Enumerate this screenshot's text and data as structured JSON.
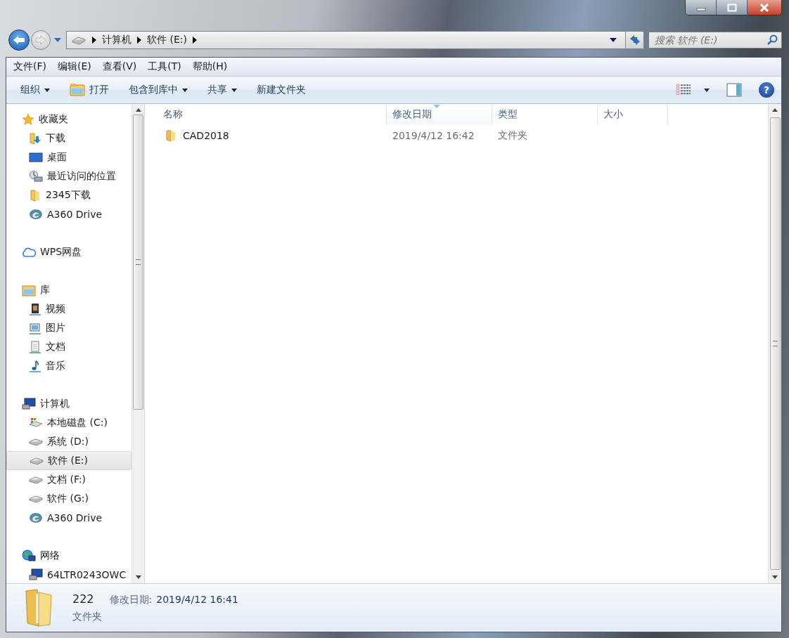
{
  "address_bar": {
    "crumbs": [
      "计算机",
      "软件 (E:)"
    ]
  },
  "search": {
    "placeholder": "搜索 软件 (E:)"
  },
  "menu": [
    "文件(F)",
    "编辑(E)",
    "查看(V)",
    "工具(T)",
    "帮助(H)"
  ],
  "toolbar": [
    {
      "label": "组织",
      "kind": "dropdown"
    },
    {
      "label": "打开",
      "kind": "open"
    },
    {
      "label": "包含到库中",
      "kind": "dropdown"
    },
    {
      "label": "共享",
      "kind": "dropdown"
    },
    {
      "label": "新建文件夹",
      "kind": "plain"
    }
  ],
  "help_button": {
    "label": "?"
  },
  "sidebar": {
    "groups": [
      {
        "label": "收藏夹",
        "kind": "star",
        "children": [
          {
            "label": "下载",
            "kind": "download",
            "selected": false
          },
          {
            "label": "桌面",
            "kind": "desktop",
            "selected": false
          },
          {
            "label": "最近访问的位置",
            "kind": "recent",
            "selected": false
          },
          {
            "label": "2345下载",
            "kind": "folder",
            "selected": false
          },
          {
            "label": "A360 Drive",
            "kind": "a360",
            "selected": false
          }
        ]
      },
      {
        "label": "WPS网盘",
        "kind": "cloud"
      },
      {
        "label": "库",
        "kind": "library",
        "children": [
          {
            "label": "视频",
            "kind": "video",
            "selected": false
          },
          {
            "label": "图片",
            "kind": "picture",
            "selected": false
          },
          {
            "label": "文档",
            "kind": "document",
            "selected": false
          },
          {
            "label": "音乐",
            "kind": "music",
            "selected": false
          }
        ]
      },
      {
        "label": "计算机",
        "kind": "computer",
        "children": [
          {
            "label": "本地磁盘 (C:)",
            "kind": "system-drive",
            "selected": false
          },
          {
            "label": "系统 (D:)",
            "kind": "drive",
            "selected": false
          },
          {
            "label": "软件 (E:)",
            "kind": "drive",
            "selected": true
          },
          {
            "label": "文档 (F:)",
            "kind": "drive",
            "selected": false
          },
          {
            "label": "软件 (G:)",
            "kind": "drive",
            "selected": false
          },
          {
            "label": "A360 Drive",
            "kind": "a360",
            "selected": false
          }
        ]
      },
      {
        "label": "网络",
        "kind": "network",
        "children": [
          {
            "label": "64LTR0243OWC",
            "kind": "pc",
            "selected": false
          }
        ]
      }
    ]
  },
  "table": {
    "columns": [
      {
        "label": "名称",
        "sorted": false
      },
      {
        "label": "修改日期",
        "sorted": true
      },
      {
        "label": "类型",
        "sorted": false
      },
      {
        "label": "大小",
        "sorted": false
      }
    ],
    "rows": [
      {
        "name": "CAD2018",
        "modified": "2019/4/12 16:42",
        "type": "文件夹"
      }
    ]
  },
  "details": {
    "name": "222",
    "modified_label": "修改日期:",
    "modified": "2019/4/12 16:41",
    "type": "文件夹"
  }
}
